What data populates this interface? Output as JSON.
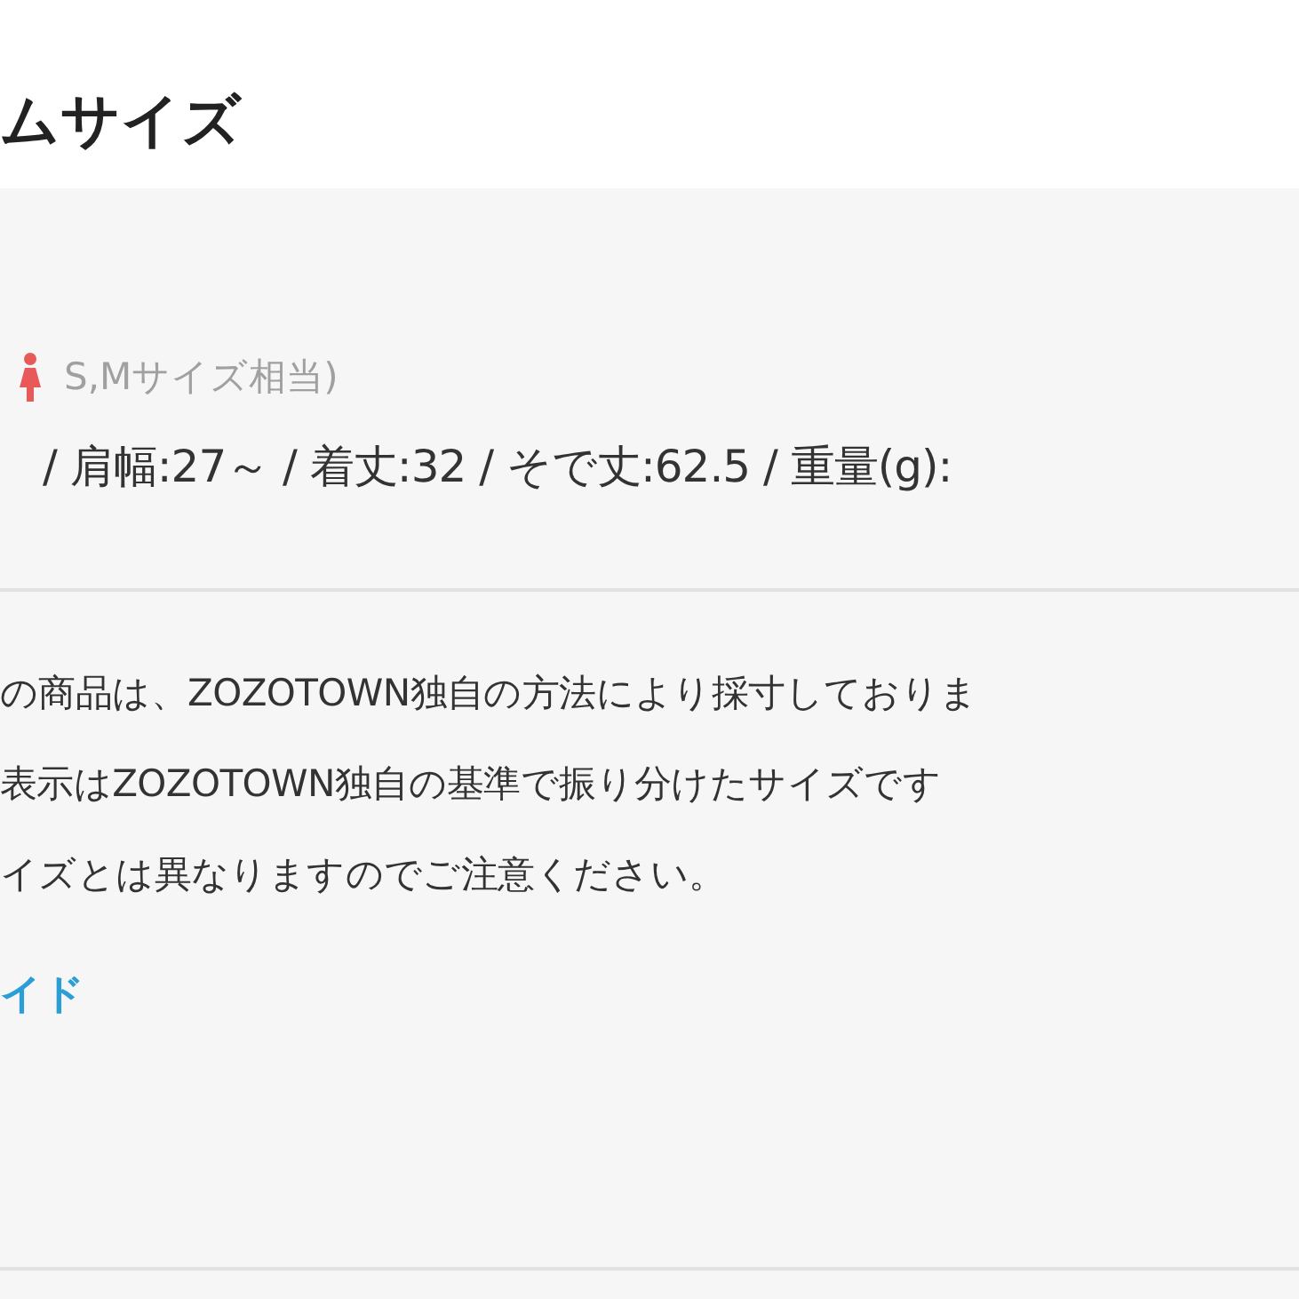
{
  "title": "ムサイズ",
  "size_label": "S,Mサイズ相当)",
  "measurements": "/ 肩幅:27～ / 着丈:32 / そで丈:62.5 / 重量(g):",
  "notice_lines": [
    "の商品は、ZOZOTOWN独自の方法により採寸しておりま",
    "表示はZOZOTOWN独自の基準で振り分けたサイズです",
    "イズとは異なりますのでご注意ください。"
  ],
  "guide_link": "イド"
}
